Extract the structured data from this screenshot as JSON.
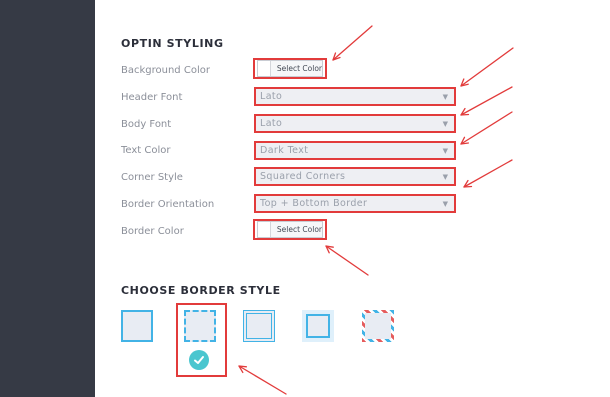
{
  "optin_styling": {
    "title": "OPTIN STYLING",
    "rows": [
      {
        "label": "Background Color",
        "button": "Select Color"
      },
      {
        "label": "Header Font",
        "value": "Lato"
      },
      {
        "label": "Body Font",
        "value": "Lato"
      },
      {
        "label": "Text Color",
        "value": "Dark Text"
      },
      {
        "label": "Corner Style",
        "value": "Squared Corners"
      },
      {
        "label": "Border Orientation",
        "value": "Top + Bottom Border"
      },
      {
        "label": "Border Color",
        "button": "Select Color"
      }
    ]
  },
  "border_style": {
    "title": "CHOOSE BORDER STYLE",
    "options": [
      "solid",
      "dashed",
      "double",
      "inset",
      "letter"
    ],
    "selected": "dashed"
  },
  "colors": {
    "sidebar": "#363a45",
    "accent_blue": "#42b3e6",
    "annotation_red": "#e23b3b",
    "check_teal": "#4ac6cf"
  },
  "icons": {
    "dropdown": "chevron-down-icon",
    "selected": "checkmark-icon"
  }
}
